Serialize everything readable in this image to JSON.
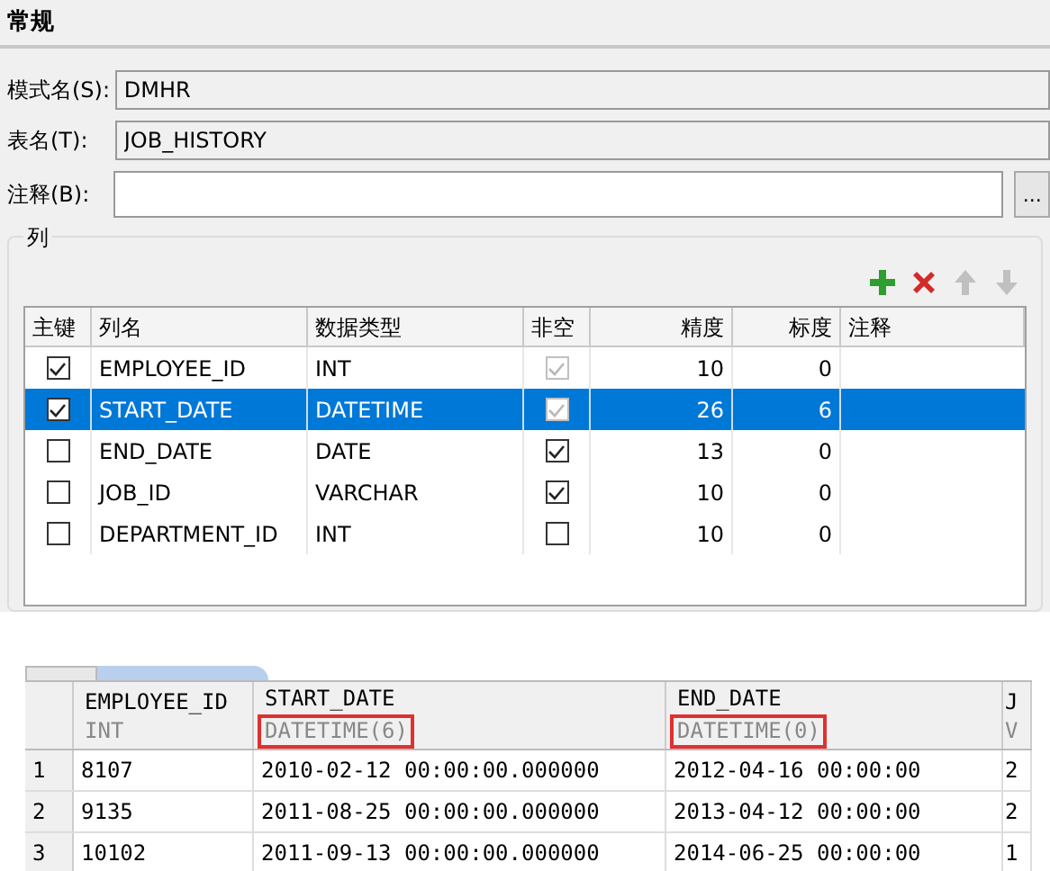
{
  "section_title": "常规",
  "fields": [
    {
      "label": "模式名(S):",
      "value": "DMHR",
      "editable": false
    },
    {
      "label": "表名(T):",
      "value": "JOB_HISTORY",
      "editable": false
    },
    {
      "label": "注释(B):",
      "editable": true,
      "button": "..."
    }
  ],
  "columns_group": {
    "title": "列",
    "toolbar": [
      {
        "kind": "add",
        "disabled": false
      },
      {
        "kind": "delete",
        "disabled": false
      },
      {
        "kind": "up",
        "disabled": true
      },
      {
        "kind": "down",
        "disabled": true
      }
    ],
    "table": {
      "columns": [
        "主键",
        "列名",
        "数据类型",
        "非空",
        "精度",
        "标度",
        "注释"
      ],
      "rows": [
        {
          "primary_key": true,
          "name": "EMPLOYEE_ID",
          "type": "INT",
          "not_null": true,
          "not_null_disabled": true,
          "precision": "10",
          "scale": "0",
          "selected": false
        },
        {
          "primary_key": true,
          "name": "START_DATE",
          "type": "DATETIME",
          "not_null": true,
          "not_null_disabled": true,
          "precision": "26",
          "scale": "6",
          "selected": true
        },
        {
          "primary_key": false,
          "name": "END_DATE",
          "type": "DATE",
          "not_null": true,
          "not_null_disabled": false,
          "precision": "13",
          "scale": "0",
          "selected": false
        },
        {
          "primary_key": false,
          "name": "JOB_ID",
          "type": "VARCHAR",
          "not_null": true,
          "not_null_disabled": false,
          "precision": "10",
          "scale": "0",
          "selected": false
        },
        {
          "primary_key": false,
          "name": "DEPARTMENT_ID",
          "type": "INT",
          "not_null": false,
          "not_null_disabled": false,
          "precision": "10",
          "scale": "0",
          "selected": false
        }
      ]
    }
  },
  "result_grid": {
    "columns": [
      {
        "name": "EMPLOYEE_ID",
        "type": "INT",
        "highlighted": false
      },
      {
        "name": "START_DATE",
        "type": "DATETIME(6)",
        "highlighted": true
      },
      {
        "name": "END_DATE",
        "type": "DATETIME(0)",
        "highlighted": true
      },
      {
        "name": "J",
        "type": "V",
        "highlighted": false
      }
    ],
    "rows": [
      {
        "number": "1",
        "cells": [
          "8107",
          "2010-02-12 00:00:00.000000",
          "2012-04-16 00:00:00",
          "2"
        ]
      },
      {
        "number": "2",
        "cells": [
          "9135",
          "2011-08-25 00:00:00.000000",
          "2013-04-12 00:00:00",
          "2"
        ]
      },
      {
        "number": "3",
        "cells": [
          "10102",
          "2011-09-13 00:00:00.000000",
          "2014-06-25 00:00:00",
          "1"
        ]
      }
    ]
  }
}
